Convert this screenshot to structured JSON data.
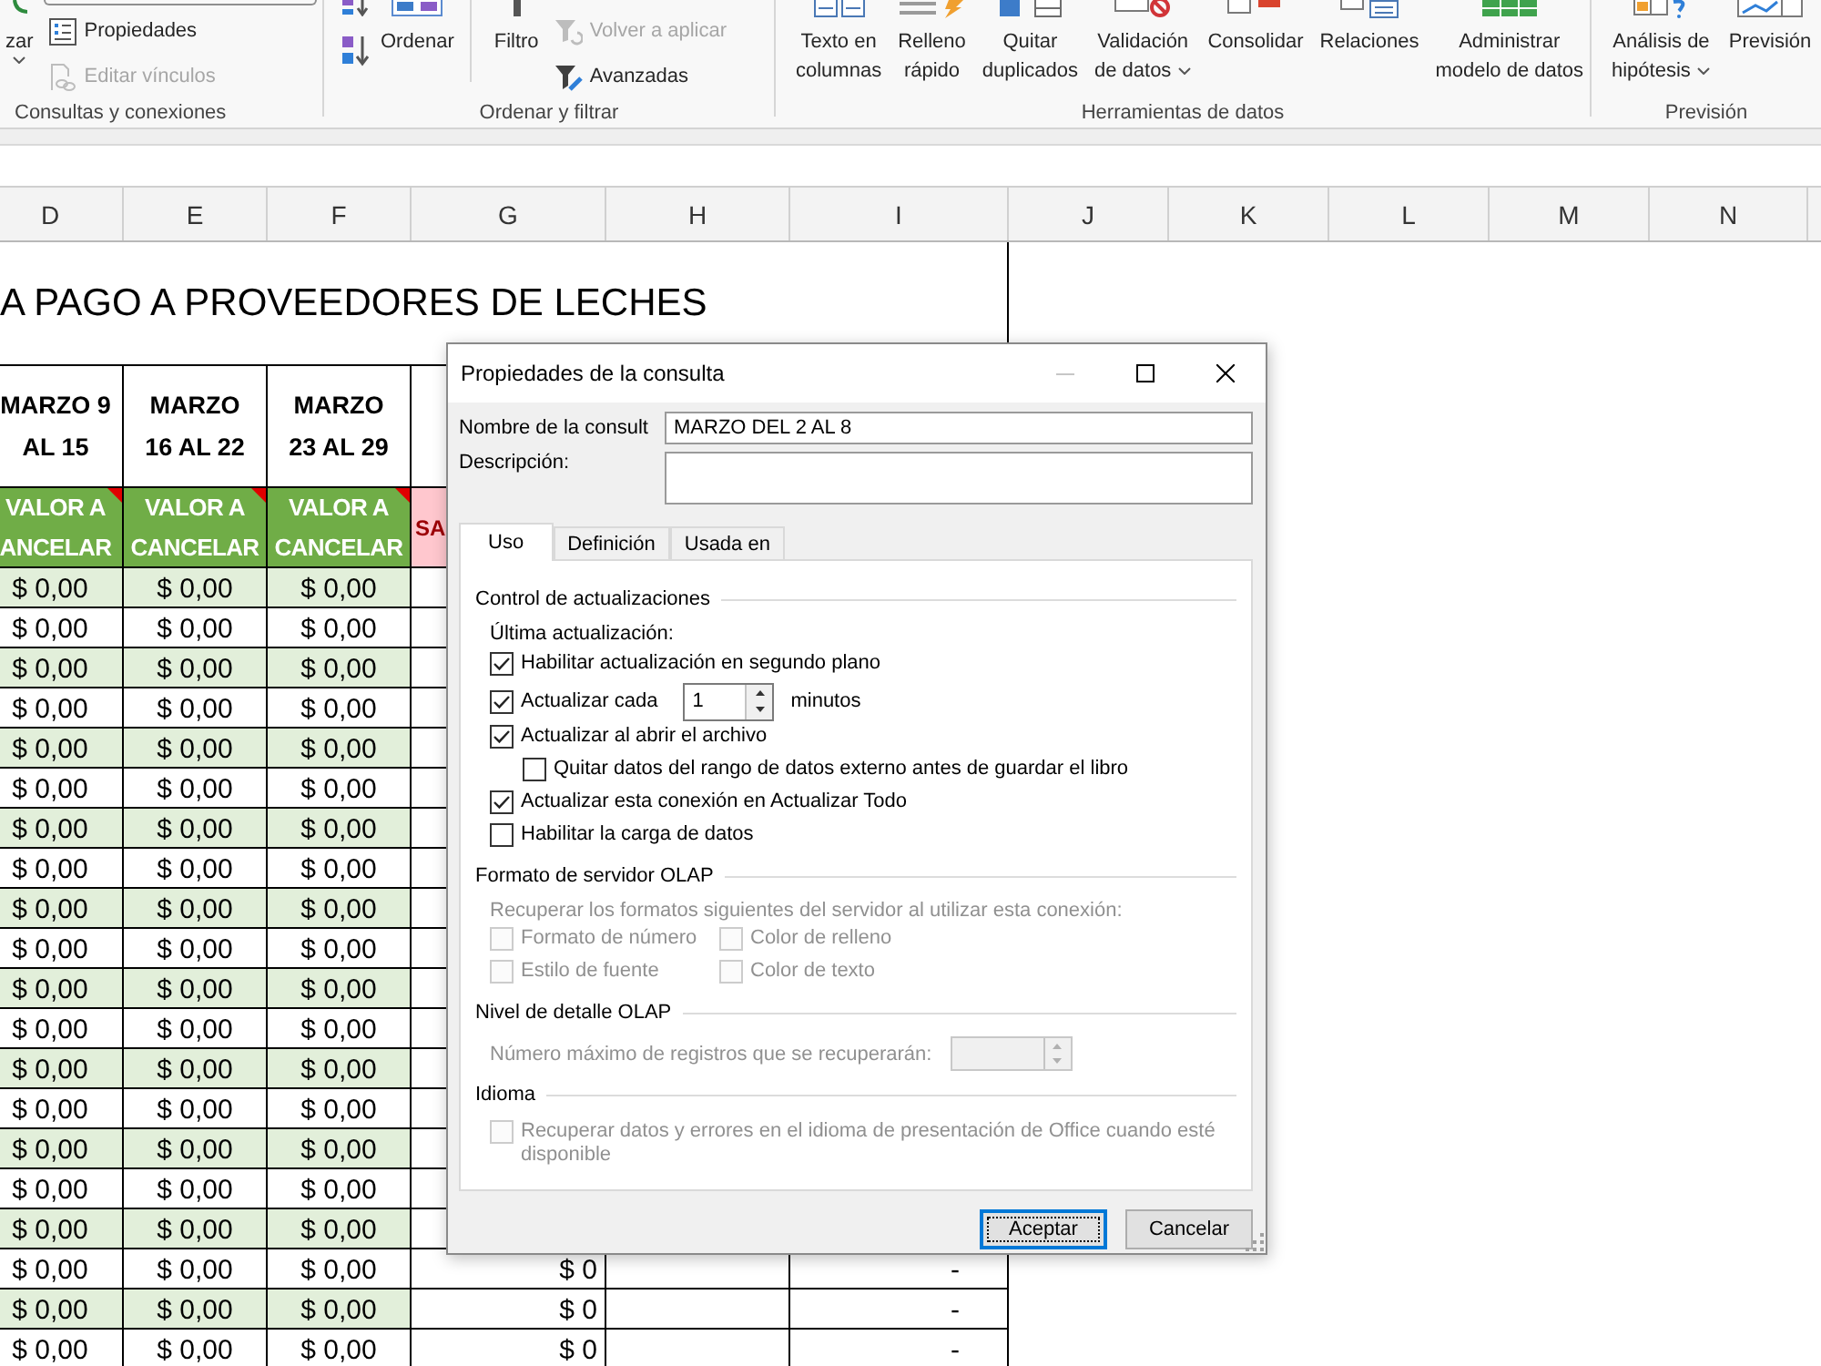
{
  "ribbon": {
    "groups": [
      {
        "label": "Consultas y conexiones",
        "columns": [
          {
            "kind": "large",
            "lines": [
              "zar"
            ],
            "dropdown": true,
            "disabled": false
          },
          {
            "kind": "stack",
            "items": [
              {
                "kind": "frame"
              },
              {
                "kind": "text",
                "label": "Propiedades",
                "disabled": false
              },
              {
                "kind": "text",
                "label": "Editar vínculos",
                "disabled": true
              }
            ]
          }
        ]
      },
      {
        "label": "Ordenar y filtrar",
        "columns": [
          {
            "kind": "icon_stack",
            "items": [
              {
                "kind": "icon",
                "disabled": false
              },
              {
                "kind": "icon",
                "disabled": false
              }
            ]
          },
          {
            "kind": "large",
            "lines": [
              "Ordenar"
            ],
            "dropdown": false,
            "disabled": false
          },
          {
            "kind": "separator"
          },
          {
            "kind": "large",
            "lines": [
              "Filtro"
            ],
            "dropdown": false,
            "disabled": false
          },
          {
            "kind": "stack",
            "items": [
              {
                "kind": "text",
                "label": "Volver a aplicar",
                "disabled": true
              },
              {
                "kind": "text",
                "label": "Avanzadas",
                "disabled": false
              }
            ]
          }
        ]
      },
      {
        "label": "Herramientas de datos",
        "columns": [
          {
            "kind": "large",
            "lines": [
              "Texto en",
              "columnas"
            ],
            "dropdown": false,
            "disabled": false
          },
          {
            "kind": "large",
            "lines": [
              "Relleno",
              "rápido"
            ],
            "dropdown": false,
            "disabled": false
          },
          {
            "kind": "large",
            "lines": [
              "Quitar",
              "duplicados"
            ],
            "dropdown": false,
            "disabled": false
          },
          {
            "kind": "large",
            "lines": [
              "Validación",
              "de datos"
            ],
            "dropdown": true,
            "disabled": false
          },
          {
            "kind": "large",
            "lines": [
              "Consolidar"
            ],
            "dropdown": false,
            "disabled": false
          },
          {
            "kind": "large",
            "lines": [
              "Relaciones"
            ],
            "dropdown": false,
            "disabled": false
          },
          {
            "kind": "large",
            "lines": [
              "Administrar",
              "modelo de datos"
            ],
            "dropdown": false,
            "disabled": false
          }
        ]
      },
      {
        "label": "Previsión",
        "columns": [
          {
            "kind": "large",
            "lines": [
              "Análisis de",
              "hipótesis"
            ],
            "dropdown": true,
            "disabled": false
          },
          {
            "kind": "large",
            "lines": [
              "Previsión"
            ],
            "dropdown": false,
            "disabled": false
          }
        ]
      }
    ]
  },
  "sheet": {
    "column_headers": [
      "D",
      "E",
      "F",
      "G",
      "H",
      "I",
      "J",
      "K",
      "L",
      "M",
      "N"
    ],
    "title": "A PAGO A PROVEEDORES DE LECHES",
    "period_headers": [
      {
        "lines": [
          "MARZO 9",
          "AL 15"
        ]
      },
      {
        "lines": [
          "MARZO",
          "16 AL 22"
        ]
      },
      {
        "lines": [
          "MARZO",
          "23 AL 29"
        ]
      }
    ],
    "value_headers": [
      {
        "kind": "accent",
        "lines": [
          "VALOR A",
          "ANCELAR"
        ],
        "comment": true
      },
      {
        "kind": "accent",
        "lines": [
          "VALOR A",
          "CANCELAR"
        ],
        "comment": true
      },
      {
        "kind": "accent",
        "lines": [
          "VALOR A",
          "CANCELAR"
        ],
        "comment": true
      },
      {
        "kind": "alert",
        "lines": [
          "SA"
        ]
      }
    ],
    "rows": [
      {
        "values": [
          "$ 0,00",
          "$ 0,00",
          "$ 0,00"
        ]
      },
      {
        "values": [
          "$ 0,00",
          "$ 0,00",
          "$ 0,00"
        ]
      },
      {
        "values": [
          "$ 0,00",
          "$ 0,00",
          "$ 0,00"
        ]
      },
      {
        "values": [
          "$ 0,00",
          "$ 0,00",
          "$ 0,00"
        ]
      },
      {
        "values": [
          "$ 0,00",
          "$ 0,00",
          "$ 0,00"
        ]
      },
      {
        "values": [
          "$ 0,00",
          "$ 0,00",
          "$ 0,00"
        ]
      },
      {
        "values": [
          "$ 0,00",
          "$ 0,00",
          "$ 0,00"
        ]
      },
      {
        "values": [
          "$ 0,00",
          "$ 0,00",
          "$ 0,00"
        ]
      },
      {
        "values": [
          "$ 0,00",
          "$ 0,00",
          "$ 0,00"
        ]
      },
      {
        "values": [
          "$ 0,00",
          "$ 0,00",
          "$ 0,00"
        ]
      },
      {
        "values": [
          "$ 0,00",
          "$ 0,00",
          "$ 0,00"
        ]
      },
      {
        "values": [
          "$ 0,00",
          "$ 0,00",
          "$ 0,00"
        ]
      },
      {
        "values": [
          "$ 0,00",
          "$ 0,00",
          "$ 0,00"
        ]
      },
      {
        "values": [
          "$ 0,00",
          "$ 0,00",
          "$ 0,00"
        ]
      },
      {
        "values": [
          "$ 0,00",
          "$ 0,00",
          "$ 0,00"
        ]
      },
      {
        "values": [
          "$ 0,00",
          "$ 0,00",
          "$ 0,00"
        ]
      },
      {
        "values": [
          "$ 0,00",
          "$ 0,00",
          "$ 0,00"
        ]
      },
      {
        "values": [
          "$ 0,00",
          "$ 0,00",
          "$ 0,00"
        ],
        "column_g": "$ 0",
        "column_i": "-"
      },
      {
        "values": [
          "$ 0,00",
          "$ 0,00",
          "$ 0,00"
        ],
        "column_g": "$ 0",
        "column_i": "-"
      },
      {
        "values": [
          "$ 0,00",
          "$ 0,00",
          "$ 0,00"
        ],
        "column_g": "$ 0",
        "column_i": "-"
      }
    ]
  },
  "dialog": {
    "title": "Propiedades de la consulta",
    "window_buttons": [
      {
        "kind": "minimize",
        "disabled": true
      },
      {
        "kind": "maximize",
        "disabled": false
      },
      {
        "kind": "close",
        "disabled": false
      }
    ],
    "name": {
      "label": "Nombre de la consult",
      "value": "MARZO DEL 2 AL 8"
    },
    "description": {
      "label": "Descripción:"
    },
    "tabs": [
      {
        "label": "Uso",
        "selected": true
      },
      {
        "label": "Definición",
        "selected": false
      },
      {
        "label": "Usada en",
        "selected": false
      }
    ],
    "sections": [
      {
        "kind": "checks",
        "title": "Control de actualizaciones",
        "note": "Última actualización:",
        "disabled": false,
        "options": [
          {
            "kind": "check",
            "label": "Habilitar actualización en segundo plano",
            "checked": true,
            "disabled": false
          },
          {
            "kind": "interval",
            "label": "Actualizar cada",
            "checked": true,
            "disabled": false,
            "value": "1",
            "unit": "minutos"
          },
          {
            "kind": "check",
            "label": "Actualizar al abrir el archivo",
            "checked": true,
            "disabled": false,
            "children": [
              {
                "kind": "check",
                "label": "Quitar datos del rango de datos externo antes de guardar el libro",
                "checked": false,
                "disabled": false
              }
            ]
          },
          {
            "kind": "check",
            "label": "Actualizar esta conexión en Actualizar Todo",
            "checked": true,
            "disabled": false
          },
          {
            "kind": "check",
            "label": "Habilitar la carga de datos",
            "checked": false,
            "disabled": false
          }
        ]
      },
      {
        "kind": "grid",
        "title": "Formato de servidor OLAP",
        "note": "Recuperar los formatos siguientes del servidor al utilizar esta conexión:",
        "disabled": true,
        "options": [
          {
            "kind": "check",
            "label": "Formato de número",
            "checked": false,
            "disabled": true
          },
          {
            "kind": "check",
            "label": "Color de relleno",
            "checked": false,
            "disabled": true
          },
          {
            "kind": "check",
            "label": "Estilo de fuente",
            "checked": false,
            "disabled": true
          },
          {
            "kind": "check",
            "label": "Color de texto",
            "checked": false,
            "disabled": true
          }
        ]
      },
      {
        "kind": "number",
        "title": "Nivel de detalle OLAP",
        "label": "Número máximo de registros que se recuperarán:",
        "disabled": true
      },
      {
        "kind": "checks",
        "title": "Idioma",
        "options": [
          {
            "kind": "check",
            "label": "Recuperar datos y errores en el idioma de presentación de Office cuando esté disponible",
            "checked": false,
            "disabled": true
          }
        ]
      }
    ],
    "buttons": [
      {
        "label": "Aceptar",
        "default": true
      },
      {
        "label": "Cancelar",
        "default": false
      }
    ]
  }
}
